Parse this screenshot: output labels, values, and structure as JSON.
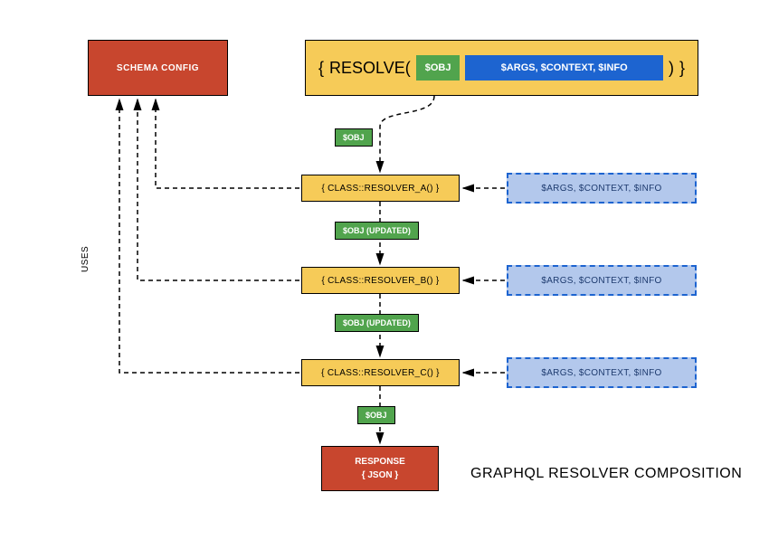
{
  "title": "GRAPHQL RESOLVER COMPOSITION",
  "schema_config": {
    "label": "SCHEMA CONFIG"
  },
  "resolve_bar": {
    "open": "{",
    "keyword": "RESOLVE(",
    "obj": "$OBJ",
    "params": "$ARGS,  $CONTEXT,  $INFO",
    "close_paren": ")",
    "close": "}"
  },
  "badges": {
    "obj1": "$OBJ",
    "obj2": "$OBJ (UPDATED)",
    "obj3": "$OBJ (UPDATED)",
    "obj4": "$OBJ"
  },
  "resolvers": {
    "a": "{  CLASS::RESOLVER_A()  }",
    "b": "{  CLASS::RESOLVER_B()  }",
    "c": "{  CLASS::RESOLVER_C()  }"
  },
  "side_args": {
    "text": "$ARGS,  $CONTEXT,  $INFO"
  },
  "response": {
    "line1": "RESPONSE",
    "line2": "{ JSON }"
  },
  "uses_label": "USES"
}
